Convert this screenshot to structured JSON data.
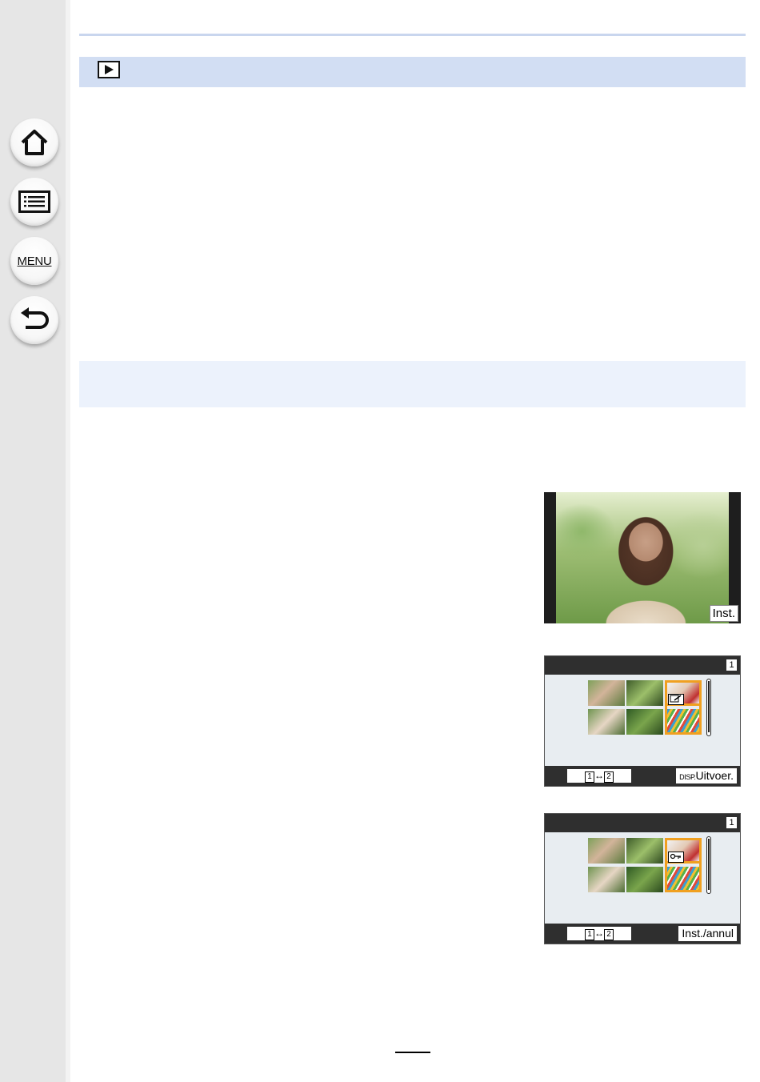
{
  "sidebar": {
    "home_icon": "home-icon",
    "contents_icon": "contents-list-icon",
    "menu_label": "MENU",
    "back_icon": "back-arrow-icon"
  },
  "mode_bar": {
    "icon": "playback-icon"
  },
  "screens": {
    "photo": {
      "button_label": "Inst."
    },
    "grid_edit": {
      "page_indicator": "1",
      "swap_left": "1",
      "swap_arrow": "↔",
      "swap_right": "2",
      "disp_label": "DISP.",
      "action_label": "Uitvoer.",
      "selected_icon": "edit-icon"
    },
    "grid_protect": {
      "page_indicator": "1",
      "swap_left": "1",
      "swap_arrow": "↔",
      "swap_right": "2",
      "action_label": "Inst./annul",
      "selected_icon": "protect-key-icon"
    }
  },
  "colors": {
    "sidebar": "#e6e6e6",
    "mode_bar": "#d2def3",
    "sub_bar": "#ecf2fc",
    "selection": "#f0a020"
  }
}
